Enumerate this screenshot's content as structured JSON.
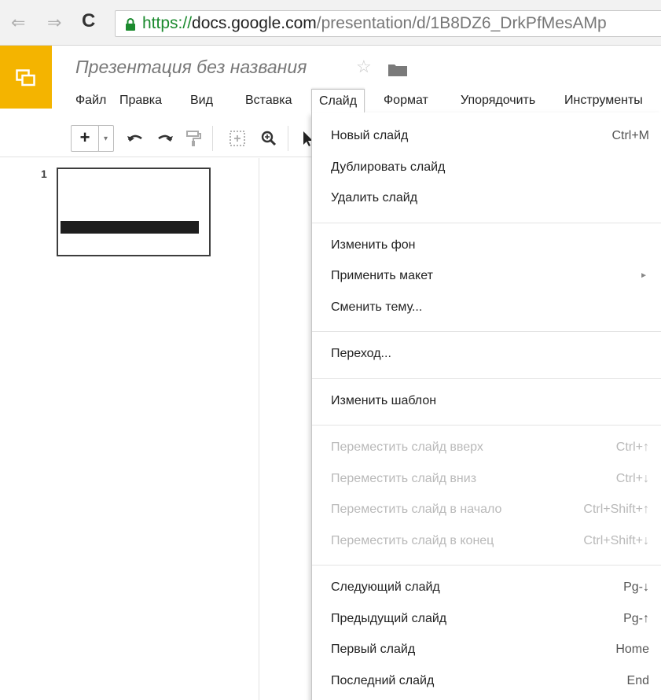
{
  "browser": {
    "back_glyph": "⇐",
    "forward_glyph": "⇒",
    "reload_glyph": "C",
    "url_scheme": "https://",
    "url_host": "docs.google.com",
    "url_path": "/presentation/d/1B8DZ6_DrkPfMesAMp"
  },
  "app": {
    "title": "Презентация без названия",
    "star_glyph": "☆",
    "brand_color": "#f4b400"
  },
  "menubar": {
    "items": [
      "Файл",
      "Правка",
      "Вид",
      "Вставка",
      "Слайд",
      "Формат",
      "Упорядочить",
      "Инструменты"
    ],
    "active": "Слайд"
  },
  "toolbar": {
    "plus_label": "+",
    "dropdown_glyph": "▾",
    "icons": [
      "undo-icon",
      "redo-icon",
      "paint-format-icon",
      "fit-icon",
      "zoom-icon",
      "select-icon"
    ]
  },
  "filmstrip": {
    "slide_number": "1"
  },
  "slide_menu": {
    "groups": [
      [
        {
          "label": "Новый слайд",
          "shortcut": "Ctrl+M",
          "enabled": true
        },
        {
          "label": "Дублировать слайд",
          "shortcut": "",
          "enabled": true
        },
        {
          "label": "Удалить слайд",
          "shortcut": "",
          "enabled": true
        }
      ],
      [
        {
          "label": "Изменить фон",
          "shortcut": "",
          "enabled": true
        },
        {
          "label": "Применить макет",
          "shortcut": "",
          "enabled": true,
          "submenu": true
        },
        {
          "label": "Сменить тему...",
          "shortcut": "",
          "enabled": true
        }
      ],
      [
        {
          "label": "Переход...",
          "shortcut": "",
          "enabled": true
        }
      ],
      [
        {
          "label": "Изменить шаблон",
          "shortcut": "",
          "enabled": true
        }
      ],
      [
        {
          "label": "Переместить слайд вверх",
          "shortcut": "Ctrl+↑",
          "enabled": false
        },
        {
          "label": "Переместить слайд вниз",
          "shortcut": "Ctrl+↓",
          "enabled": false
        },
        {
          "label": "Переместить слайд в начало",
          "shortcut": "Ctrl+Shift+↑",
          "enabled": false
        },
        {
          "label": "Переместить слайд в конец",
          "shortcut": "Ctrl+Shift+↓",
          "enabled": false
        }
      ],
      [
        {
          "label": "Следующий слайд",
          "shortcut": "Pg-↓",
          "enabled": true
        },
        {
          "label": "Предыдущий слайд",
          "shortcut": "Pg-↑",
          "enabled": true
        },
        {
          "label": "Первый слайд",
          "shortcut": "Home",
          "enabled": true
        },
        {
          "label": "Последний слайд",
          "shortcut": "End",
          "enabled": true
        }
      ]
    ],
    "submenu_glyph": "►"
  }
}
